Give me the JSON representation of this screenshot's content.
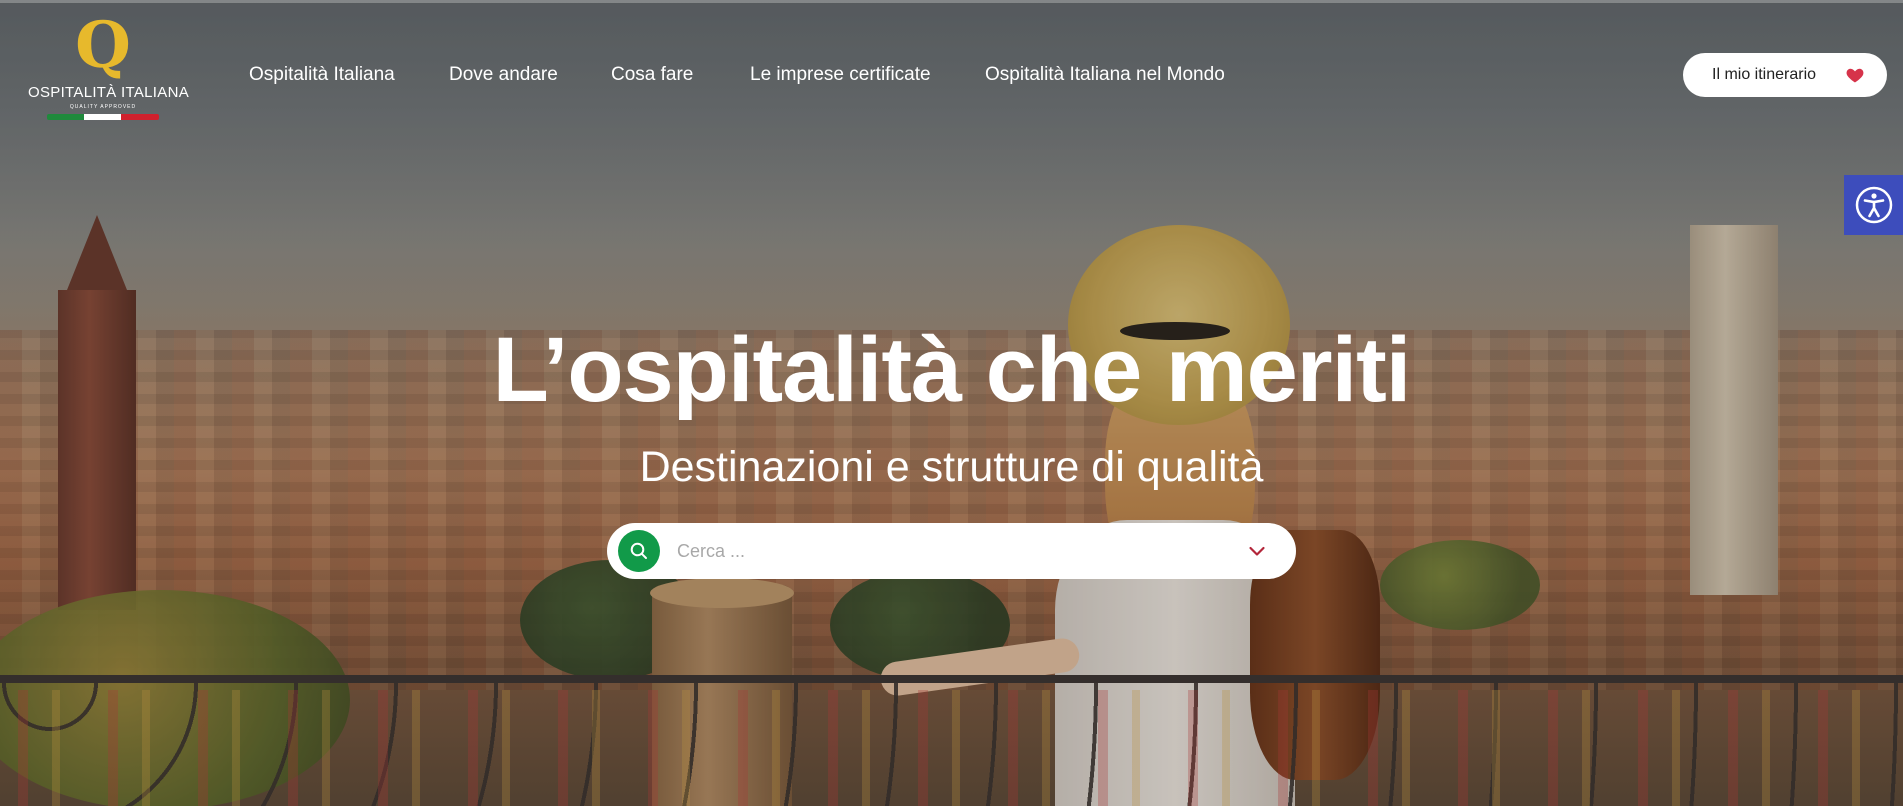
{
  "logo": {
    "letter": "Q",
    "name": "OSPITALITÀ ITALIANA",
    "tagline": "QUALITY APPROVED"
  },
  "nav": {
    "items": [
      {
        "label": "Ospitalità Italiana"
      },
      {
        "label": "Dove andare"
      },
      {
        "label": "Cosa fare"
      },
      {
        "label": "Le imprese certificate"
      },
      {
        "label": "Ospitalità Italiana nel Mondo"
      }
    ]
  },
  "itinerary": {
    "label": "Il mio itinerario",
    "icon": "heart-icon",
    "icon_color": "#d6334a"
  },
  "accessibility": {
    "icon": "accessibility-icon",
    "color": "#3d4dbc"
  },
  "hero": {
    "title": "L’ospitalità che meriti",
    "subtitle": "Destinazioni e strutture di qualità"
  },
  "search": {
    "placeholder": "Cerca ...",
    "value": "",
    "button_icon": "search-icon",
    "button_color": "#119a49",
    "dropdown_icon": "chevron-down-icon",
    "dropdown_color": "#b3263a"
  }
}
